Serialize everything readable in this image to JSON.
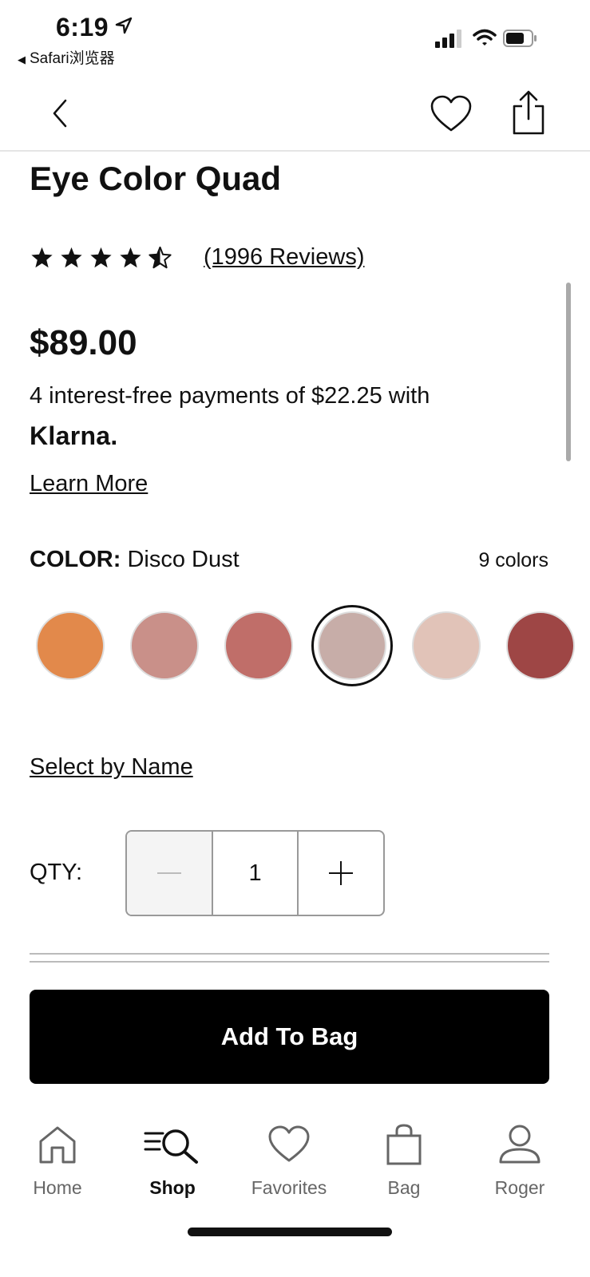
{
  "status_bar": {
    "time": "6:19",
    "back_app": "Safari浏览器"
  },
  "nav": {
    "back_icon": "chevron-left-icon",
    "favorite_icon": "heart-outline-icon",
    "share_icon": "share-icon"
  },
  "product": {
    "title": "Eye Color Quad",
    "rating": 4.5,
    "reviews": "(1996 Reviews)",
    "price": "$89.00",
    "installments": "4 interest-free payments of $22.25 with",
    "klarna": "Klarna.",
    "learn_more": "Learn More"
  },
  "color": {
    "label": "COLOR:",
    "selected_name": "Disco Dust",
    "count": "9 colors",
    "swatches": [
      {
        "color": "#e2894b",
        "selected": false
      },
      {
        "color": "#c99089",
        "selected": false
      },
      {
        "color": "#c06e69",
        "selected": false
      },
      {
        "color": "#c7ada8",
        "selected": true
      },
      {
        "color": "#e1c3b8",
        "selected": false
      },
      {
        "color": "#9e4645",
        "selected": false
      }
    ],
    "select_by_name": "Select by Name"
  },
  "qty": {
    "label": "QTY:",
    "value": "1"
  },
  "cta": {
    "add_to_bag": "Add To Bag"
  },
  "tabs": [
    {
      "label": "Home",
      "icon": "home-icon",
      "active": false
    },
    {
      "label": "Shop",
      "icon": "search-list-icon",
      "active": true
    },
    {
      "label": "Favorites",
      "icon": "heart-icon",
      "active": false
    },
    {
      "label": "Bag",
      "icon": "bag-icon",
      "active": false
    },
    {
      "label": "Roger",
      "icon": "user-icon",
      "active": false
    }
  ]
}
